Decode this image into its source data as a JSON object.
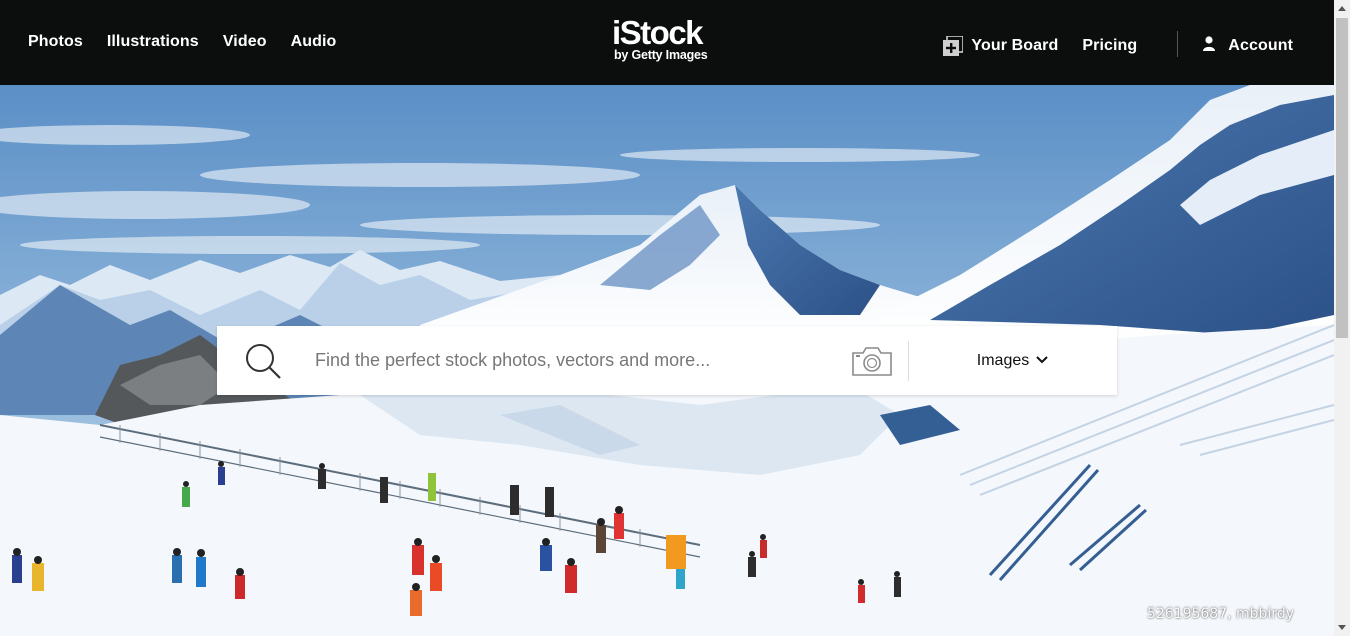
{
  "nav": {
    "links": [
      "Photos",
      "Illustrations",
      "Video",
      "Audio"
    ],
    "logo_main": "iStock",
    "logo_sub": "by Getty Images",
    "board_label": "Your Board",
    "pricing_label": "Pricing",
    "account_label": "Account"
  },
  "search": {
    "placeholder": "Find the perfect stock photos, vectors and more...",
    "value": "",
    "type_selected": "Images"
  },
  "hero": {
    "image_credit": "526195687, mbbirdy"
  },
  "colors": {
    "nav_bg": "#0c0d0d",
    "sky_top": "#5b8fc6",
    "snow": "#f4f7fb"
  },
  "icons": {
    "board": "plus-board-icon",
    "account": "user-icon",
    "search": "search-icon",
    "camera": "camera-icon",
    "dropdown": "chevron-down-icon"
  }
}
